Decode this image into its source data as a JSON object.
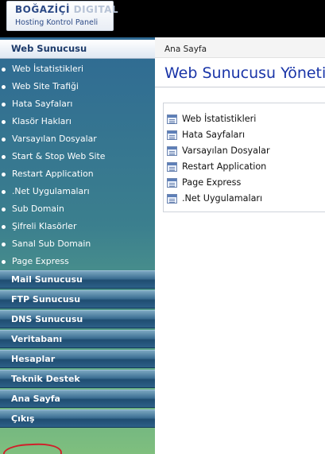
{
  "header": {
    "logo_primary": "BOĞAZİÇİ",
    "logo_accent": "DIGITAL",
    "logo_subtitle": "Hosting Kontrol Paneli"
  },
  "sidebar": {
    "active_section": "Web Sunucusu",
    "sub_items": [
      "Web İstatistikleri",
      "Web Site Trafiği",
      "Hata Sayfaları",
      "Klasör Hakları",
      "Varsayılan Dosyalar",
      "Start & Stop Web Site",
      "Restart Application",
      ".Net Uygulamaları",
      "Sub Domain",
      "Şifreli Klasörler",
      "Sanal Sub Domain",
      "Page Express"
    ],
    "sections": [
      "Mail Sunucusu",
      "FTP Sunucusu",
      "DNS Sunucusu",
      "Veritabanı",
      "Hesaplar",
      "Teknik Destek",
      "Ana Sayfa",
      "Çıkış"
    ],
    "colors": {
      "highlight_circle": "#d0202a"
    }
  },
  "main": {
    "breadcrumb": "Ana Sayfa",
    "title": "Web Sunucusu Yöneti",
    "links": [
      "Web İstatistikleri",
      "Hata Sayfaları",
      "Varsayılan Dosyalar",
      "Restart Application",
      "Page Express",
      ".Net Uygulamaları"
    ],
    "colors": {
      "title": "#1a35a8"
    },
    "icon": "document-list-icon"
  }
}
